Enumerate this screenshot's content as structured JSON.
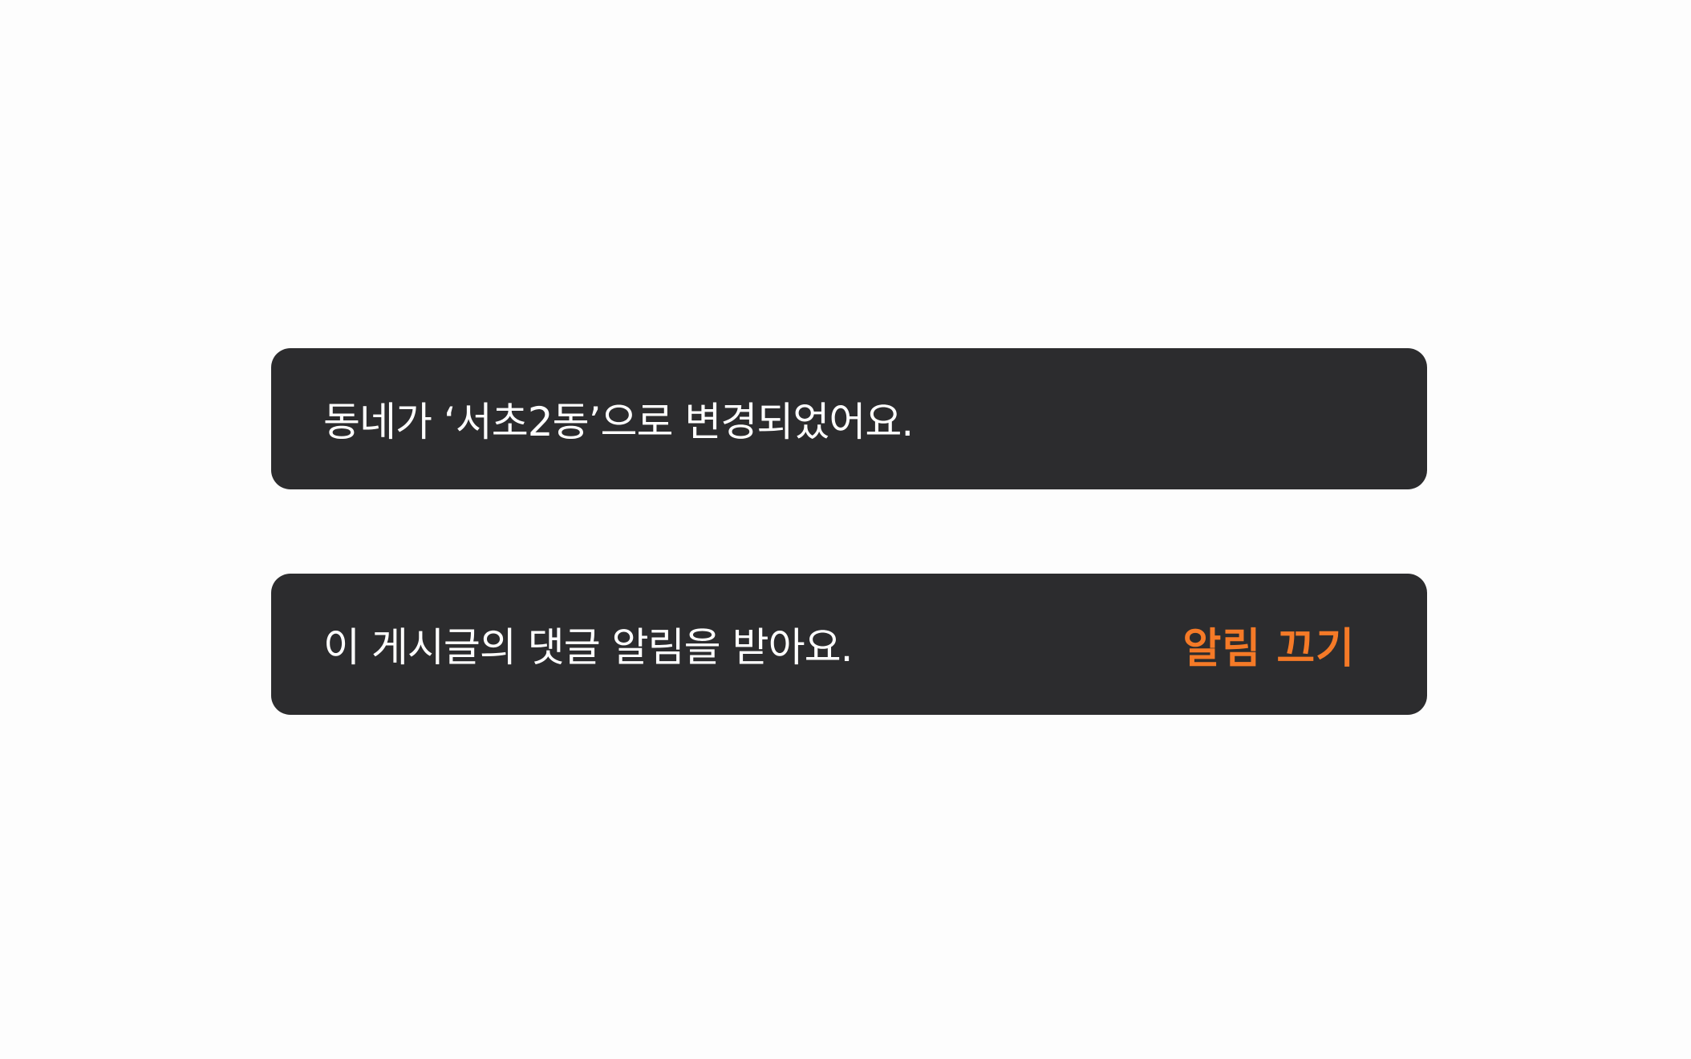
{
  "snackbars": [
    {
      "message": "동네가 ‘서초2동’으로 변경되었어요."
    },
    {
      "message": "이 게시글의 댓글 알림을 받아요.",
      "action_label": "알림 끄기"
    }
  ],
  "colors": {
    "page_background": "#fdfdfd",
    "snackbar_background": "#2c2c2e",
    "message_text": "#ffffff",
    "action_text": "#f57a27"
  }
}
